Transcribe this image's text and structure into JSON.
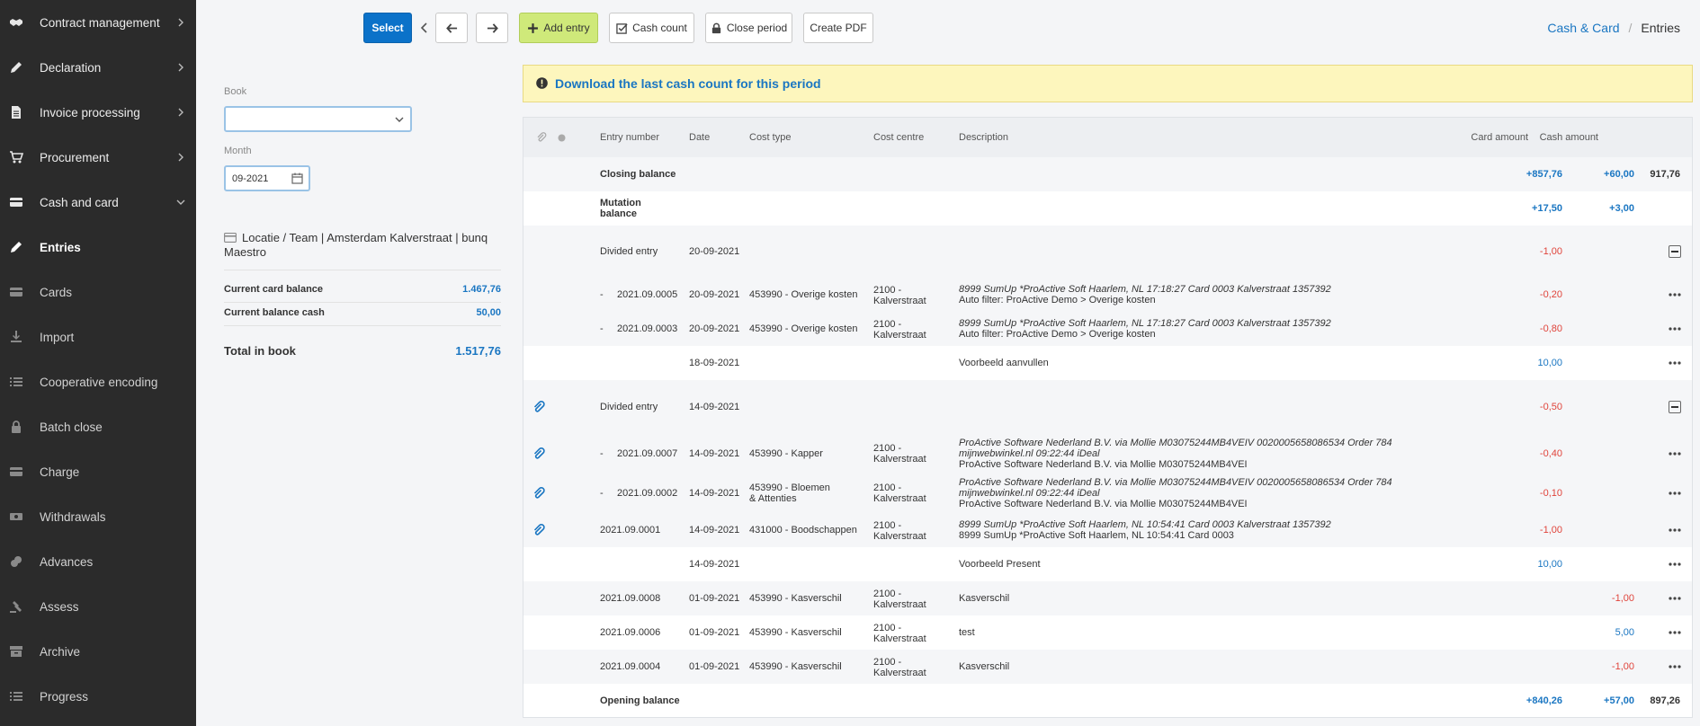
{
  "sidebar": {
    "items": [
      {
        "label": "Contract management",
        "icon": "handshake-icon",
        "chevron": "right"
      },
      {
        "label": "Declaration",
        "icon": "pencil-icon",
        "chevron": "right"
      },
      {
        "label": "Invoice processing",
        "icon": "document-icon",
        "chevron": "right"
      },
      {
        "label": "Procurement",
        "icon": "cart-icon",
        "chevron": "right"
      },
      {
        "label": "Cash and card",
        "icon": "card-icon",
        "chevron": "down"
      },
      {
        "label": "Entries",
        "icon": "pencil-icon"
      },
      {
        "label": "Cards",
        "icon": "card-icon"
      },
      {
        "label": "Import",
        "icon": "import-icon"
      },
      {
        "label": "Cooperative encoding",
        "icon": "list-icon"
      },
      {
        "label": "Batch close",
        "icon": "lock-icon"
      },
      {
        "label": "Charge",
        "icon": "card-icon"
      },
      {
        "label": "Withdrawals",
        "icon": "money-icon"
      },
      {
        "label": "Advances",
        "icon": "coins-icon"
      },
      {
        "label": "Assess",
        "icon": "gavel-icon"
      },
      {
        "label": "Archive",
        "icon": "archive-icon"
      },
      {
        "label": "Progress",
        "icon": "list-icon"
      }
    ]
  },
  "toolbar": {
    "select_label": "Select",
    "add_entry_label": "Add entry",
    "cash_count_label": "Cash count",
    "close_period_label": "Close period",
    "create_pdf_label": "Create PDF"
  },
  "breadcrumb": {
    "link": "Cash & Card",
    "separator": "/",
    "current": "Entries"
  },
  "filters": {
    "book_label": "Book",
    "book_value": "",
    "month_label": "Month",
    "month_value": "09-2021"
  },
  "location": {
    "name": "Locatie / Team | Amsterdam Kalverstraat | bunq Maestro"
  },
  "balances": {
    "card_label": "Current card balance",
    "card_value": "1.467,76",
    "cash_label": "Current balance cash",
    "cash_value": "50,00",
    "total_label": "Total in book",
    "total_value": "1.517,76"
  },
  "banner": {
    "text": "Download the last cash count for this period"
  },
  "table": {
    "columns": {
      "entry_number": "Entry number",
      "date": "Date",
      "cost_type": "Cost type",
      "cost_centre": "Cost centre",
      "description": "Description",
      "card_amount": "Card amount",
      "cash_amount": "Cash amount"
    },
    "closing": {
      "label": "Closing balance",
      "card": "+857,76",
      "cash": "+60,00",
      "total": "917,76"
    },
    "mutation": {
      "label": "Mutation balance",
      "card": "+17,50",
      "cash": "+3,00"
    },
    "rows": [
      {
        "kind": "divided",
        "entry": "Divided entry",
        "date": "20-09-2021",
        "card": "-1,00"
      },
      {
        "kind": "entry",
        "prefix": "-",
        "entry": "2021.09.0005",
        "date": "20-09-2021",
        "cost_type": "453990 - Overige kosten",
        "cost_centre": "2100 - Kalverstraat",
        "desc1": "8999 SumUp *ProActive Soft Haarlem, NL 17:18:27 Card 0003 Kalverstraat 1357392",
        "desc2": "Auto filter: ProActive Demo > Overige kosten",
        "card": "-0,20"
      },
      {
        "kind": "entry",
        "prefix": "-",
        "entry": "2021.09.0003",
        "date": "20-09-2021",
        "cost_type": "453990 - Overige kosten",
        "cost_centre": "2100 - Kalverstraat",
        "desc1": "8999 SumUp *ProActive Soft Haarlem, NL 17:18:27 Card 0003 Kalverstraat 1357392",
        "desc2": "Auto filter: ProActive Demo > Overige kosten",
        "card": "-0,80"
      },
      {
        "kind": "simple",
        "date": "18-09-2021",
        "desc": "Voorbeeld aanvullen",
        "card": "10,00"
      },
      {
        "kind": "divided",
        "entry": "Divided entry",
        "date": "14-09-2021",
        "card": "-0,50",
        "attachment": true
      },
      {
        "kind": "entry",
        "prefix": "-",
        "entry": "2021.09.0007",
        "date": "14-09-2021",
        "cost_type": "453990 - Kapper",
        "cost_centre": "2100 - Kalverstraat",
        "desc1": "ProActive Software Nederland B.V. via Mollie M03075244MB4VEIV 0020005658086534 Order 784 mijnwebwinkel.nl 09:22:44 iDeal",
        "desc2": "ProActive Software Nederland B.V. via Mollie M03075244MB4VEI",
        "card": "-0,40",
        "attachment": true
      },
      {
        "kind": "entry",
        "prefix": "-",
        "entry": "2021.09.0002",
        "date": "14-09-2021",
        "cost_type": "453990 - Bloemen & Attenties",
        "cost_centre": "2100 - Kalverstraat",
        "desc1": "ProActive Software Nederland B.V. via Mollie M03075244MB4VEIV 0020005658086534 Order 784 mijnwebwinkel.nl 09:22:44 iDeal",
        "desc2": "ProActive Software Nederland B.V. via Mollie M03075244MB4VEI",
        "card": "-0,10",
        "attachment": true
      },
      {
        "kind": "entry",
        "entry": "2021.09.0001",
        "date": "14-09-2021",
        "cost_type": "431000 - Boodschappen",
        "cost_centre": "2100 - Kalverstraat",
        "desc1": "8999 SumUp *ProActive Soft Haarlem, NL 10:54:41 Card 0003 Kalverstraat 1357392",
        "desc2": "8999 SumUp *ProActive Soft Haarlem, NL 10:54:41 Card 0003",
        "card": "-1,00",
        "attachment": true
      },
      {
        "kind": "simple",
        "date": "14-09-2021",
        "desc": "Voorbeeld Present",
        "card": "10,00"
      },
      {
        "kind": "entry",
        "entry": "2021.09.0008",
        "date": "01-09-2021",
        "cost_type": "453990 - Kasverschil",
        "cost_centre": "2100 - Kalverstraat",
        "desc": "Kasverschil",
        "cash": "-1,00"
      },
      {
        "kind": "entry",
        "entry": "2021.09.0006",
        "date": "01-09-2021",
        "cost_type": "453990 - Kasverschil",
        "cost_centre": "2100 - Kalverstraat",
        "desc": "test",
        "cash": "5,00"
      },
      {
        "kind": "entry",
        "entry": "2021.09.0004",
        "date": "01-09-2021",
        "cost_type": "453990 - Kasverschil",
        "cost_centre": "2100 - Kalverstraat",
        "desc": "Kasverschil",
        "cash": "-1,00"
      }
    ],
    "opening": {
      "label": "Opening balance",
      "card": "+840,26",
      "cash": "+57,00",
      "total": "897,26"
    }
  }
}
